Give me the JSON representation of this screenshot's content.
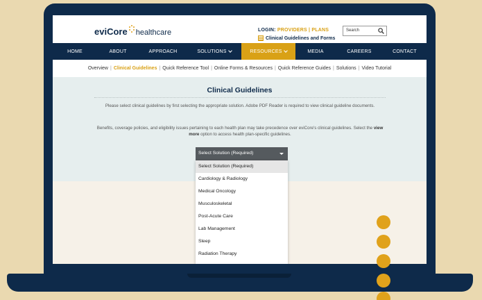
{
  "header": {
    "logo_text": "eviCore",
    "logo_sub": "healthcare",
    "login_label": "LOGIN:",
    "providers": "PROVIDERS",
    "divider": "|",
    "plans": "PLANS",
    "guidelines_link": "Clinical Guidelines and Forms",
    "search_placeholder": "Search"
  },
  "nav": {
    "items": [
      {
        "label": "HOME"
      },
      {
        "label": "ABOUT"
      },
      {
        "label": "APPROACH"
      },
      {
        "label": "SOLUTIONS"
      },
      {
        "label": "RESOURCES"
      },
      {
        "label": "MEDIA"
      },
      {
        "label": "CAREERS"
      },
      {
        "label": "CONTACT"
      }
    ]
  },
  "subnav": {
    "items": [
      {
        "label": "Overview"
      },
      {
        "label": "Clinical Guidelines"
      },
      {
        "label": "Quick Reference Tool"
      },
      {
        "label": "Online Forms & Resources"
      },
      {
        "label": "Quick Reference Guides"
      },
      {
        "label": "Solutions"
      },
      {
        "label": "Video Tutorial"
      }
    ]
  },
  "main": {
    "title": "Clinical Guidelines",
    "para1": "Please select clinical guidelines by first selecting the appropriate solution. Adobe PDF Reader is required to view clinical guideline documents.",
    "para2_a": "Benefits, coverage policies, and eligibility issues pertaining to each health plan may take precedence over eviCore's clinical guidelines. Select the ",
    "para2_b": "view more",
    "para2_c": " option to access health plan-specific guidelines."
  },
  "dropdown": {
    "selected": "Select Solution (Required)",
    "options": [
      {
        "label": "Select Solution (Required)"
      },
      {
        "label": "Cardiology & Radiology"
      },
      {
        "label": "Medical Oncology"
      },
      {
        "label": "Musculoskeletal"
      },
      {
        "label": "Post-Acute Care"
      },
      {
        "label": "Lab Management"
      },
      {
        "label": "Sleep"
      },
      {
        "label": "Radiation Therapy"
      }
    ]
  },
  "colors": {
    "navy": "#0e2a4a",
    "gold": "#d9a116",
    "background": "#ead9b0"
  }
}
